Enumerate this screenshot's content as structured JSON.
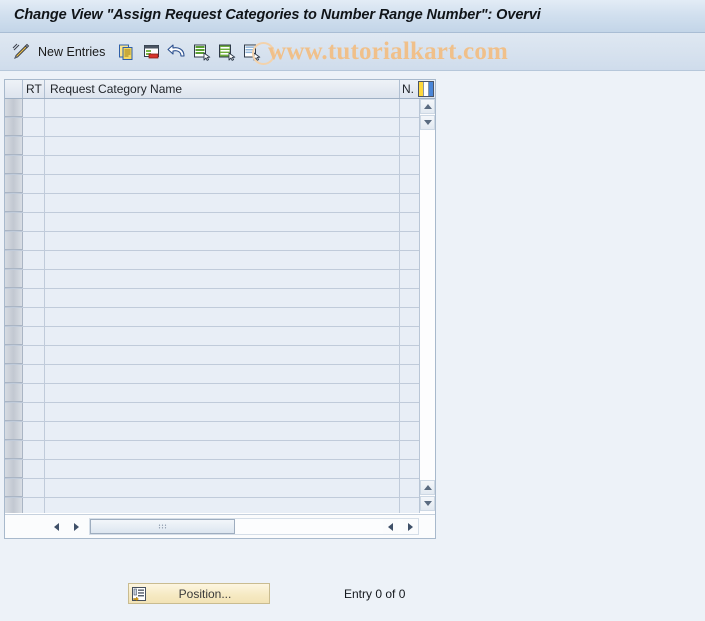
{
  "window": {
    "title": "Change View \"Assign Request Categories to Number Range Number\": Overvi"
  },
  "toolbar": {
    "edit_icon": "pencil-edit-icon",
    "new_entries_label": "New Entries",
    "buttons": [
      {
        "name": "copy-as-icon",
        "label": "Copy As..."
      },
      {
        "name": "delete-icon",
        "label": "Delete"
      },
      {
        "name": "undo-icon",
        "label": "Undo Change"
      },
      {
        "name": "select-all-icon",
        "label": "Select All"
      },
      {
        "name": "select-block-icon",
        "label": "Select Block"
      },
      {
        "name": "deselect-all-icon",
        "label": "Deselect All"
      }
    ]
  },
  "watermark": {
    "text": "www.tutorialkart.com",
    "color": "#f0c08a"
  },
  "table": {
    "columns": [
      {
        "key": "sel",
        "label": ""
      },
      {
        "key": "rt",
        "label": "RT"
      },
      {
        "key": "name",
        "label": "Request Category Name"
      },
      {
        "key": "n",
        "label": "N."
      }
    ],
    "config_icon": "column-settings-icon",
    "row_count": 22,
    "rows": [],
    "scrollbars": {
      "vertical_up_icon": "scroll-up-icon",
      "vertical_down_icon": "scroll-down-icon",
      "horizontal_left_icon": "scroll-left-icon",
      "horizontal_right_icon": "scroll-right-icon"
    }
  },
  "footer": {
    "position_button_label": "Position...",
    "position_button_icon": "position-list-icon",
    "entry_status": "Entry 0 of 0"
  },
  "colors": {
    "title_bar": "#d2e0ef",
    "toolbar": "#d6e1ee",
    "page_background": "#edf2f8",
    "grid_cell": "#e8eef6",
    "grid_line": "#c0cbda",
    "button_yellow": "#f6eac4"
  }
}
